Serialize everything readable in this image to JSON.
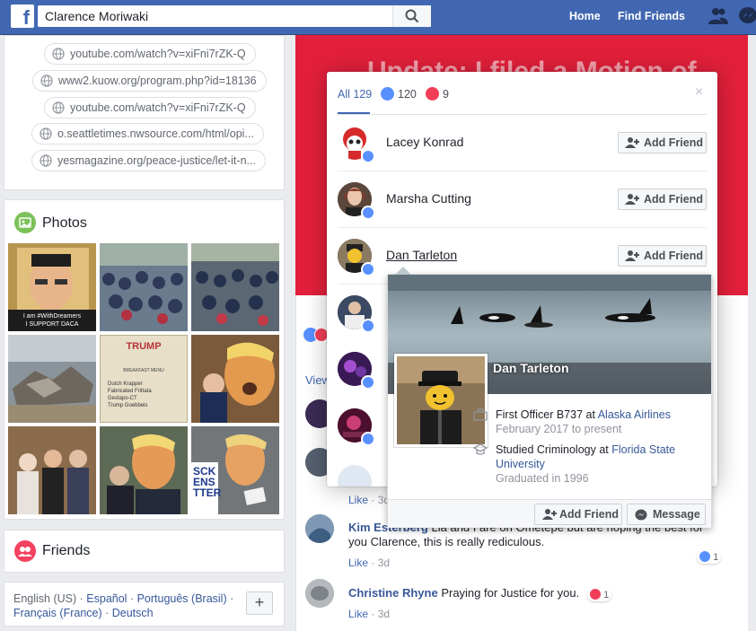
{
  "topbar": {
    "search_value": "Clarence Moriwaki",
    "nav_home": "Home",
    "nav_find_friends": "Find Friends",
    "icons": [
      "friend-requests-icon",
      "messenger-icon"
    ]
  },
  "links": [
    "youtube.com/watch?v=xiFni7rZK-Q",
    "www2.kuow.org/program.php?id=18136",
    "youtube.com/watch?v=xiFni7rZK-Q",
    "o.seattletimes.nwsource.com/html/opi...",
    "yesmagazine.org/peace-justice/let-it-n..."
  ],
  "photos": {
    "title": "Photos",
    "items": [
      {
        "caption_lines": [
          "I am #WithDreamers",
          "I SUPPORT DACA"
        ]
      },
      {
        "caption_lines": []
      },
      {
        "caption_lines": []
      },
      {
        "caption_lines": []
      },
      {
        "caption_lines": [
          "TRUMP",
          "BREAKFAST MENU",
          "Dutch Krapper",
          "Fabricated Frittata",
          "Gestapo-CT",
          "Trump Goebbels"
        ]
      },
      {
        "caption_lines": []
      },
      {
        "caption_lines": []
      },
      {
        "caption_lines": []
      },
      {
        "caption_lines": [
          "SCK",
          "ENS",
          "TTER"
        ]
      }
    ]
  },
  "friends": {
    "title": "Friends"
  },
  "languages": {
    "current": "English (US)",
    "options": [
      "Español",
      "Português (Brasil)",
      "Français (France)",
      "Deutsch"
    ],
    "add_label": "+"
  },
  "post": {
    "banner_text": "Update: I filed a Motion of",
    "view_more": "View"
  },
  "dialog": {
    "tab_all": "All 129",
    "tab_like": "120",
    "tab_love": "9",
    "close_label": "×",
    "people": [
      {
        "name": "Lacey Konrad",
        "button": "Add Friend"
      },
      {
        "name": "Marsha Cutting",
        "button": "Add Friend"
      },
      {
        "name": "Dan Tarleton",
        "button": "Add Friend"
      },
      {
        "name": "",
        "button": ""
      },
      {
        "name": "",
        "button": ""
      },
      {
        "name": "",
        "button": ""
      }
    ]
  },
  "hovercard": {
    "name": "Dan Tarleton",
    "work_title": "First Officer B737 at ",
    "work_company": "Alaska Airlines",
    "work_dates": "February 2017 to present",
    "edu_prefix": "Studied Criminology at ",
    "edu_school": "Florida State University",
    "edu_year": "Graduated in 1996",
    "add_friend": "Add Friend",
    "message": "Message"
  },
  "comments": [
    {
      "name": "",
      "text": "",
      "like": "Like",
      "time": "3d"
    },
    {
      "name": "Kim Esterberg",
      "text": "Lia and I are on Ometepe but are hoping the best for you Clarence, this is really rediculous.",
      "like": "Like",
      "time": "3d",
      "reactions": "1"
    },
    {
      "name": "Christine Rhyne",
      "text": "Praying for Justice for you.",
      "like": "Like",
      "time": "3d",
      "reactions": "1"
    }
  ],
  "colors": {
    "brand": "#4267b2",
    "banner": "#e3203b",
    "like": "#5890ff",
    "love": "#f33e58"
  }
}
